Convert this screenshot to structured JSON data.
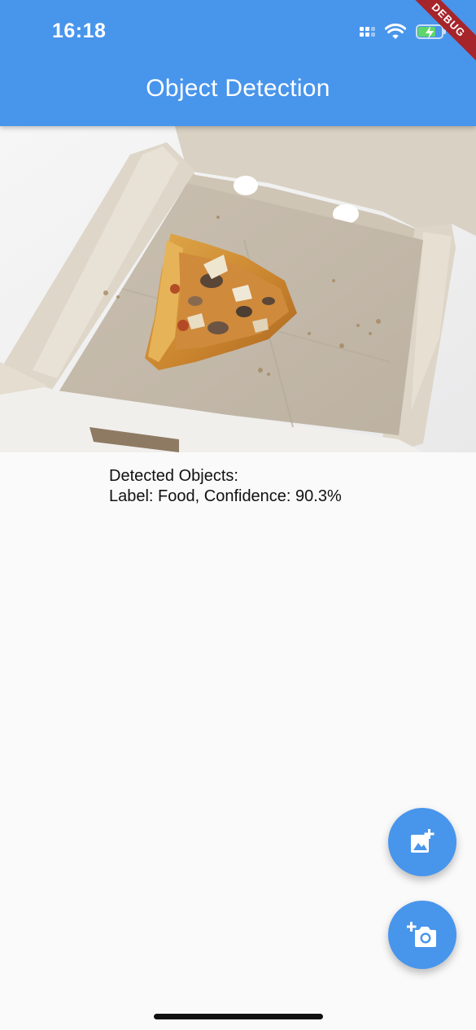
{
  "status_bar": {
    "time": "16:18",
    "icons": [
      "cellular-signal-icon",
      "wifi-icon",
      "battery-charging-icon"
    ]
  },
  "debug_banner": "DEBUG",
  "app_bar": {
    "title": "Object Detection"
  },
  "image": {
    "description_icon": "pizza-photo"
  },
  "results": {
    "heading": "Detected Objects:",
    "items": [
      {
        "text": "Label: Food, Confidence: 90.3%"
      }
    ]
  },
  "fabs": [
    {
      "icon": "add-photo-gallery-icon"
    },
    {
      "icon": "add-camera-icon"
    }
  ],
  "colors": {
    "primary": "#4895ec",
    "background": "#fafafa",
    "debug": "#a6252b"
  }
}
